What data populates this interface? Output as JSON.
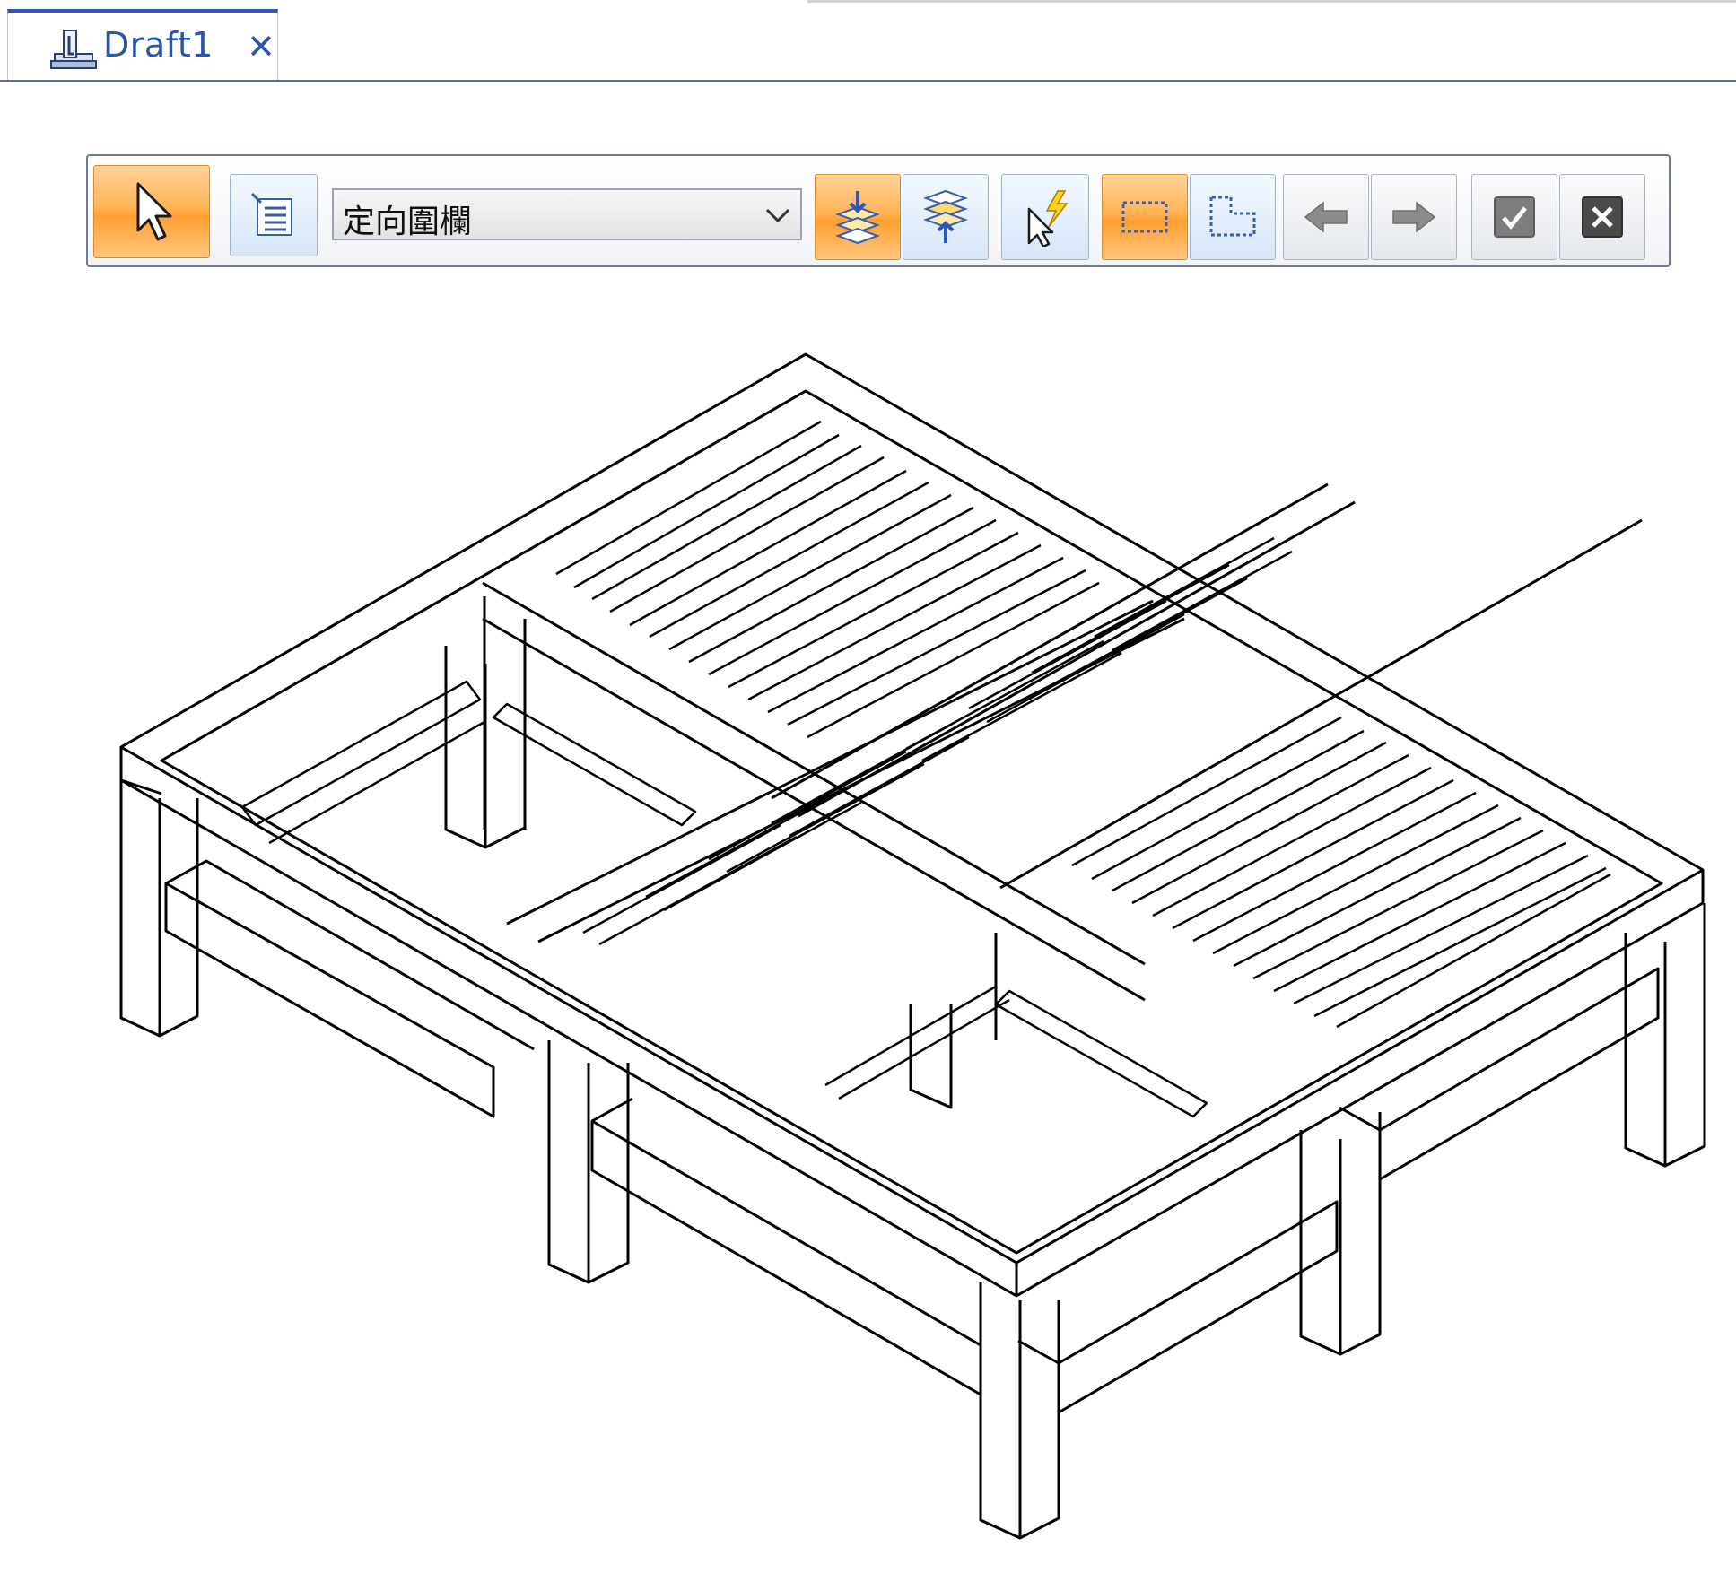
{
  "tab": {
    "title": "Draft1",
    "close": "✕",
    "icon": "draft-document-icon"
  },
  "command_bar": {
    "select_tool_icon": "select-arrow-icon",
    "properties_icon": "properties-list-icon",
    "filter_combo": {
      "value": "定向圍欄"
    },
    "buttons": [
      {
        "name": "add-to-selection-icon",
        "active": true
      },
      {
        "name": "remove-from-selection-icon",
        "active": false
      },
      {
        "name": "quick-pick-icon",
        "active": false
      },
      {
        "name": "rectangle-fence-icon",
        "active": true
      },
      {
        "name": "multi-line-fence-icon",
        "active": false
      },
      {
        "name": "previous-arrow-icon",
        "active": false
      },
      {
        "name": "next-arrow-icon",
        "active": false
      },
      {
        "name": "accept-check-icon",
        "active": false
      },
      {
        "name": "cancel-x-icon",
        "active": false
      }
    ],
    "colors": {
      "active_orange": "#ffa940",
      "accent_blue": "#2a55a8"
    }
  },
  "drawing": {
    "subject": "isometric-line-drawing",
    "line_color": "#000000",
    "background": "#ffffff"
  }
}
